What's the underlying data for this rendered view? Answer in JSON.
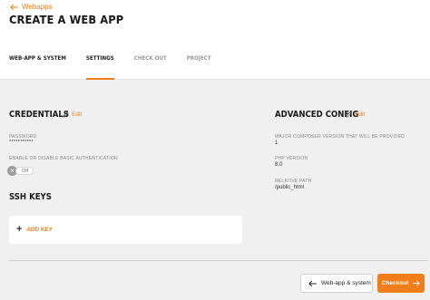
{
  "header": {
    "back_label": "Webapps",
    "title": "CREATE A WEB APP"
  },
  "tabs": [
    {
      "label": "WEB-APP & SYSTEM"
    },
    {
      "label": "SETTINGS"
    },
    {
      "label": "CHECK OUT"
    },
    {
      "label": "PROJECT"
    }
  ],
  "credentials": {
    "title": "CREDENTIALS",
    "edit_label": "Edit",
    "password_label": "PASSWORD",
    "password_value": "***********",
    "auth_label": "ENABLE OR DISABLE BASIC AUTHENTICATION",
    "toggle_state": "Off"
  },
  "ssh_keys": {
    "title": "SSH KEYS",
    "add_label": "ADD KEY"
  },
  "advanced_config": {
    "title": "ADVANCED CONFIG",
    "edit_label": "Edit",
    "composer_label": "MAJOR COMPOSER VERSION THAT WILL BE PROVIDED",
    "composer_value": "1",
    "php_label": "PHP VERSION",
    "php_value": "8.0",
    "path_label": "RELATIVE PATH",
    "path_value": "/public_html"
  },
  "footer": {
    "back_button_label": "Web-app & system",
    "checkout_button_label": "Checkout"
  },
  "colors": {
    "accent": "#ef7d1a"
  }
}
